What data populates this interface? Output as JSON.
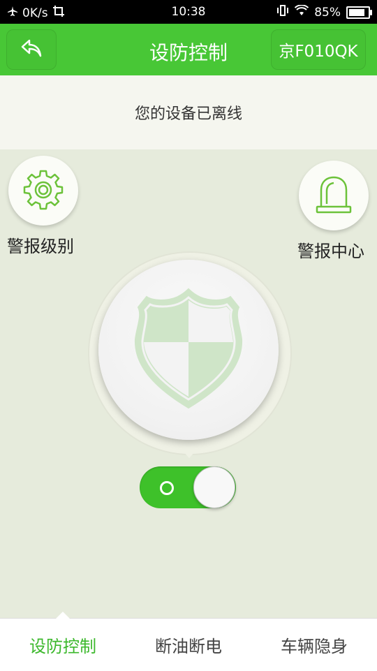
{
  "status_bar": {
    "net_speed": "0K/s",
    "time": "10:38",
    "battery": "85%",
    "battery_level": 0.85
  },
  "header": {
    "title": "设防控制",
    "plate": "京F010QK"
  },
  "banner": {
    "message": "您的设备已离线"
  },
  "actions": {
    "alarm_level": "警报级别",
    "alarm_center": "警报中心"
  },
  "toggle": {
    "state": "on"
  },
  "tabs": [
    {
      "label": "设防控制",
      "active": true
    },
    {
      "label": "断油断电",
      "active": false
    },
    {
      "label": "车辆隐身",
      "active": false
    }
  ],
  "colors": {
    "accent": "#48c736",
    "background": "#e6ebdc",
    "icon_green": "#6cc23a"
  },
  "icons": {
    "back": "back-arrow-icon",
    "alarm_level": "gear-icon",
    "alarm_center": "siren-icon",
    "shield": "shield-icon"
  }
}
